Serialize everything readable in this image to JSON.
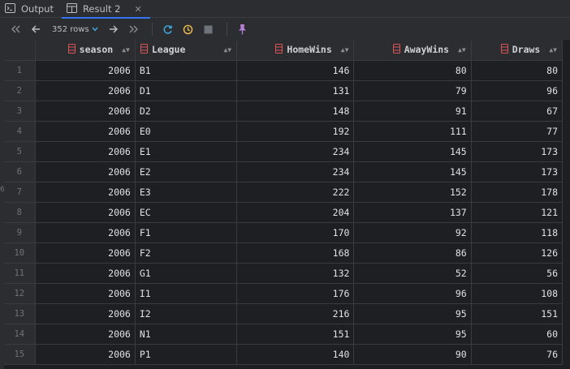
{
  "tabs": [
    {
      "label": "Output",
      "icon": "terminal-icon"
    },
    {
      "label": "Result 2",
      "icon": "table-icon",
      "close": "✕"
    }
  ],
  "toolbar": {
    "rows_label": "352 rows",
    "accent_colors": {
      "refresh": "#3ea7d8",
      "history": "#e6b450",
      "pin": "#b87fd9",
      "db_icon": "#d9555a"
    }
  },
  "table": {
    "columns": [
      "season",
      "League",
      "HomeWins",
      "AwayWins",
      "Draws"
    ],
    "rows": [
      {
        "n": "1",
        "season": "2006",
        "league": "B1",
        "home": "146",
        "away": "80",
        "draws": "80"
      },
      {
        "n": "2",
        "season": "2006",
        "league": "D1",
        "home": "131",
        "away": "79",
        "draws": "96"
      },
      {
        "n": "3",
        "season": "2006",
        "league": "D2",
        "home": "148",
        "away": "91",
        "draws": "67"
      },
      {
        "n": "4",
        "season": "2006",
        "league": "E0",
        "home": "192",
        "away": "111",
        "draws": "77"
      },
      {
        "n": "5",
        "season": "2006",
        "league": "E1",
        "home": "234",
        "away": "145",
        "draws": "173"
      },
      {
        "n": "6",
        "season": "2006",
        "league": "E2",
        "home": "234",
        "away": "145",
        "draws": "173"
      },
      {
        "n": "7",
        "season": "2006",
        "league": "E3",
        "home": "222",
        "away": "152",
        "draws": "178"
      },
      {
        "n": "8",
        "season": "2006",
        "league": "EC",
        "home": "204",
        "away": "137",
        "draws": "121"
      },
      {
        "n": "9",
        "season": "2006",
        "league": "F1",
        "home": "170",
        "away": "92",
        "draws": "118"
      },
      {
        "n": "10",
        "season": "2006",
        "league": "F2",
        "home": "168",
        "away": "86",
        "draws": "126"
      },
      {
        "n": "11",
        "season": "2006",
        "league": "G1",
        "home": "132",
        "away": "52",
        "draws": "56"
      },
      {
        "n": "12",
        "season": "2006",
        "league": "I1",
        "home": "176",
        "away": "96",
        "draws": "108"
      },
      {
        "n": "13",
        "season": "2006",
        "league": "I2",
        "home": "216",
        "away": "95",
        "draws": "151"
      },
      {
        "n": "14",
        "season": "2006",
        "league": "N1",
        "home": "151",
        "away": "95",
        "draws": "60"
      },
      {
        "n": "15",
        "season": "2006",
        "league": "P1",
        "home": "140",
        "away": "90",
        "draws": "76"
      }
    ]
  }
}
